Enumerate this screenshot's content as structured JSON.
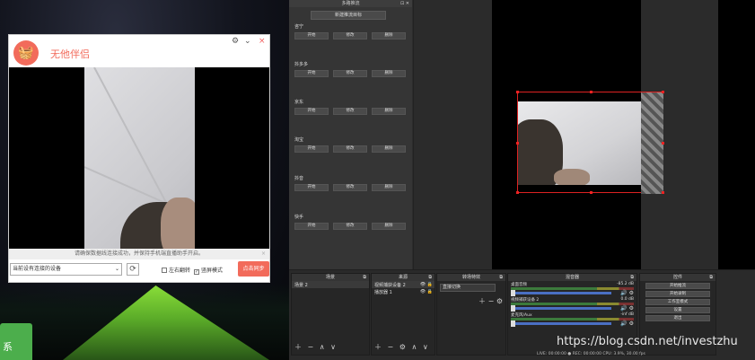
{
  "phone_window": {
    "app_title": "无他伴侣",
    "tip_text": "请确保数据线连接成功，并保持手机端直播助手开启。",
    "device_select": "当前设有连接的设备",
    "mirror_label": "左右翻转",
    "landscape_label": "竖屏模式",
    "start_button": "点击同步",
    "close": "×",
    "min": "⌄",
    "settings": "⚙"
  },
  "obs": {
    "left_dock": {
      "title": "多路推流",
      "new_button": "新建推流目标",
      "platforms": [
        {
          "name": "咨宁"
        },
        {
          "name": "抖多多"
        },
        {
          "name": "京东"
        },
        {
          "name": "淘宝"
        },
        {
          "name": "抖音"
        },
        {
          "name": "快手"
        }
      ],
      "btn_start": "开始",
      "btn_edit": "修改",
      "btn_delete": "删除"
    },
    "scenes": {
      "title": "场景",
      "items": [
        "场景 2"
      ],
      "tools": "＋ − ∧ ∨"
    },
    "sources": {
      "title": "来源",
      "items": [
        "视频捕获设备 2",
        "播放器 1"
      ],
      "tools": "＋ − ⚙ ∧ ∨"
    },
    "transitions": {
      "title": "转场特效",
      "selected": "直接切换",
      "tools": "＋ − ⚙"
    },
    "mixer": {
      "title": "混音器",
      "rows": [
        {
          "name": "桌面音频",
          "db": "-85.2 dB"
        },
        {
          "name": "视频捕获设备 2",
          "db": "0.0 dB"
        },
        {
          "name": "麦克风/Aux",
          "db": "-inf dB"
        }
      ]
    },
    "controls": {
      "title": "控件",
      "buttons": [
        "开始推流",
        "开始录制",
        "工作室模式",
        "设置",
        "退出"
      ]
    },
    "status": "LIVE: 00:00:00   ● REC: 00:00:00   CPU: 3.9%, 30.00 fps"
  },
  "watermark": "https://blog.csdn.net/investzhu",
  "desktop_tile": "系"
}
